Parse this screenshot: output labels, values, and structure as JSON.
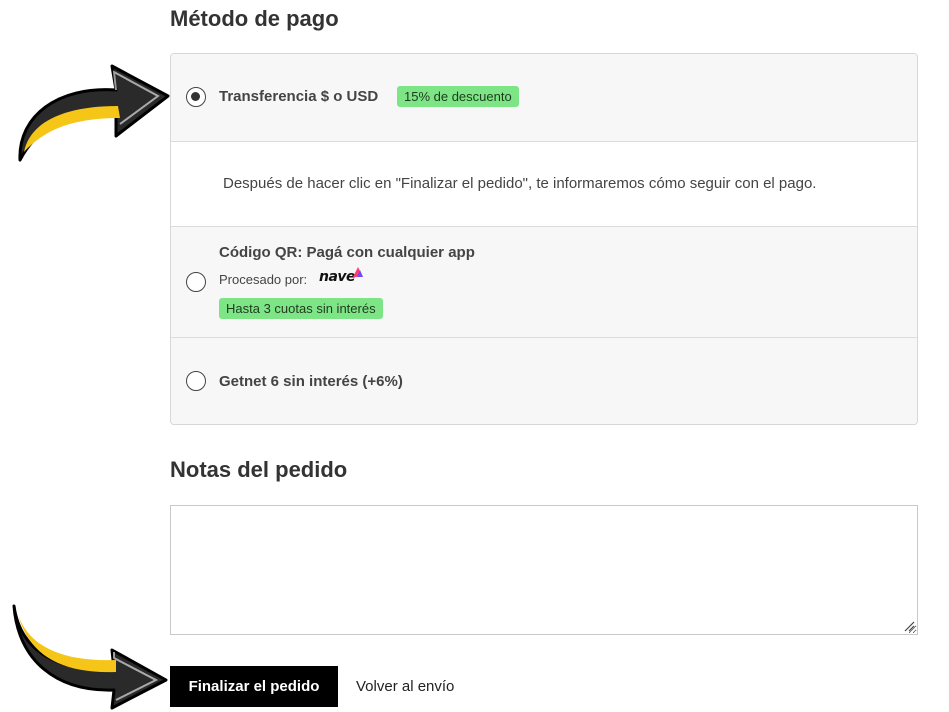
{
  "payment": {
    "title": "Método de pago",
    "options": [
      {
        "label": "Transferencia $ o USD",
        "badge": "15% de descuento",
        "selected": true,
        "info": "Después de hacer clic en \"Finalizar el pedido\", te informaremos cómo seguir con el pago."
      },
      {
        "label": "Código QR: Pagá con cualquier app",
        "processed_by": "Procesado por:",
        "provider_logo": "nave",
        "badge": "Hasta 3 cuotas sin interés",
        "selected": false
      },
      {
        "label": "Getnet 6 sin interés (+6%)",
        "selected": false
      }
    ]
  },
  "notes": {
    "title": "Notas del pedido",
    "value": ""
  },
  "actions": {
    "submit_label": "Finalizar el pedido",
    "back_label": "Volver al envío"
  },
  "colors": {
    "badge_bg": "#7ee587",
    "submit_bg": "#000000",
    "arrow_fill": "#f5c518",
    "arrow_dark": "#2a2a2a"
  },
  "icons": {
    "arrow_top": "curved-arrow-right-icon",
    "arrow_bottom": "curved-arrow-right-icon",
    "radio": "radio-icon",
    "resize": "resize-grip-icon"
  }
}
